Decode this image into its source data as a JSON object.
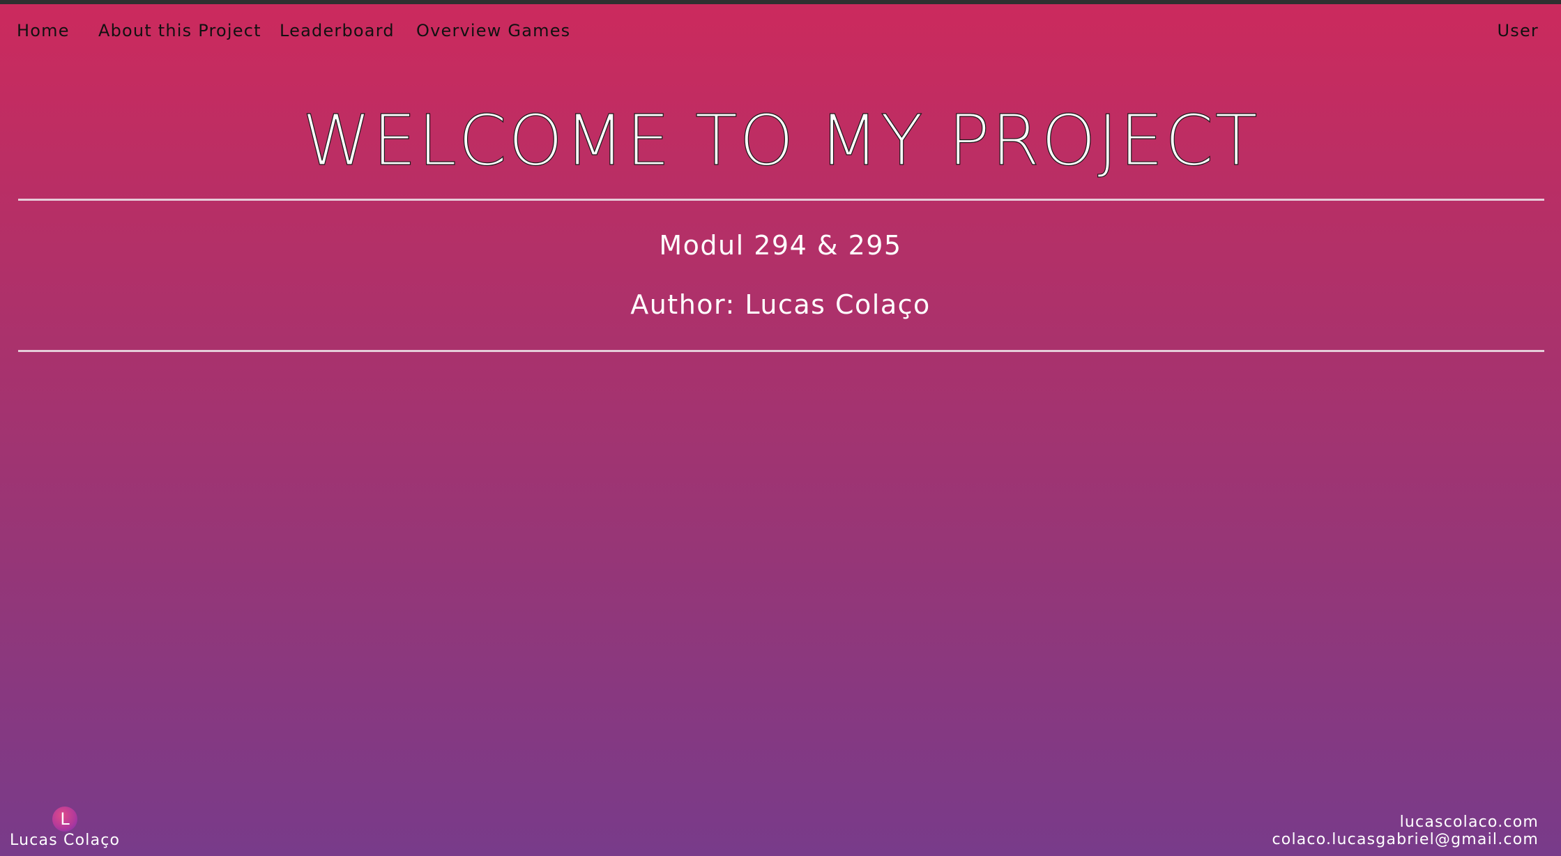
{
  "nav": {
    "items": [
      {
        "label": "Home"
      },
      {
        "label": "About this Project"
      },
      {
        "label": "Leaderboard"
      },
      {
        "label": "Overview Games"
      }
    ],
    "user_label": "User"
  },
  "hero": {
    "title": "WELCOME TO MY PROJECT",
    "module": "Modul 294 & 295",
    "author": "Author: Lucas Colaço"
  },
  "footer": {
    "avatar_letter": "L",
    "name": "Lucas Colaço",
    "website": "lucascolaco.com",
    "email": "colaco.lucasgabriel@gmail.com"
  },
  "colors": {
    "gradient_top": "#cc2a5d",
    "gradient_bottom": "#783b8a",
    "topbar": "#303030",
    "nav_text": "#111111",
    "text": "#ffffff"
  }
}
